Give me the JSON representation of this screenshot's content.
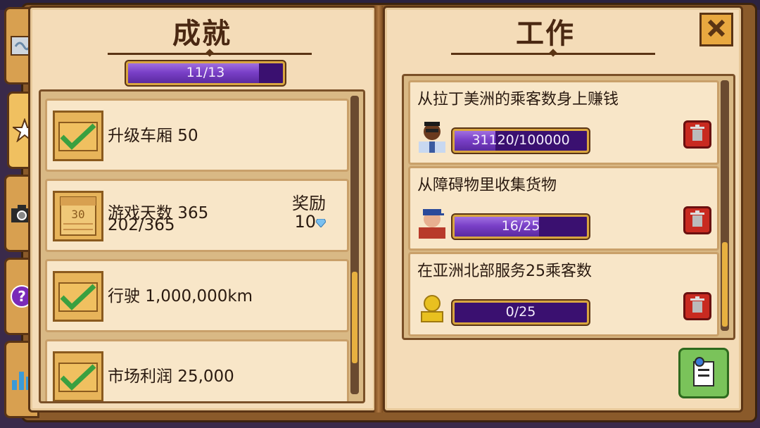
{
  "left_page": {
    "title": "成就",
    "progress": {
      "text": "11/13",
      "fraction": 0.846
    },
    "achievements": [
      {
        "label": "升级车厢 50",
        "status": "completed"
      },
      {
        "label": "游戏天数 365",
        "sub": "202/365",
        "status": "in-progress",
        "calendar_number": "30",
        "reward_label": "奖励",
        "reward_value": "10"
      },
      {
        "label": "行驶 1,000,000km",
        "status": "completed"
      },
      {
        "label": "市场利润 25,000",
        "status": "completed"
      }
    ]
  },
  "right_page": {
    "title": "工作",
    "jobs": [
      {
        "title": "从拉丁美洲的乘客数身上赚钱",
        "progress_text": "31120/100000",
        "fraction": 0.311,
        "avatar": "passenger-man-glasses-icon"
      },
      {
        "title": "从障碍物里收集货物",
        "progress_text": "16/25",
        "fraction": 0.64,
        "avatar": "passenger-man-cap-icon"
      },
      {
        "title": "在亚洲北部服务25乘客数",
        "progress_text": "0/25",
        "fraction": 0.0,
        "avatar": "gold-trophy-icon"
      }
    ]
  },
  "tabs": [
    "map-tab",
    "achievements-tab",
    "photo-tab",
    "help-tab",
    "stats-tab"
  ],
  "colors": {
    "progress_bg": "#3a1070",
    "progress_fill": "#7a40c8",
    "page": "#f4dcb8",
    "accent_gold": "#e8a840",
    "trash_red": "#c82a20"
  }
}
